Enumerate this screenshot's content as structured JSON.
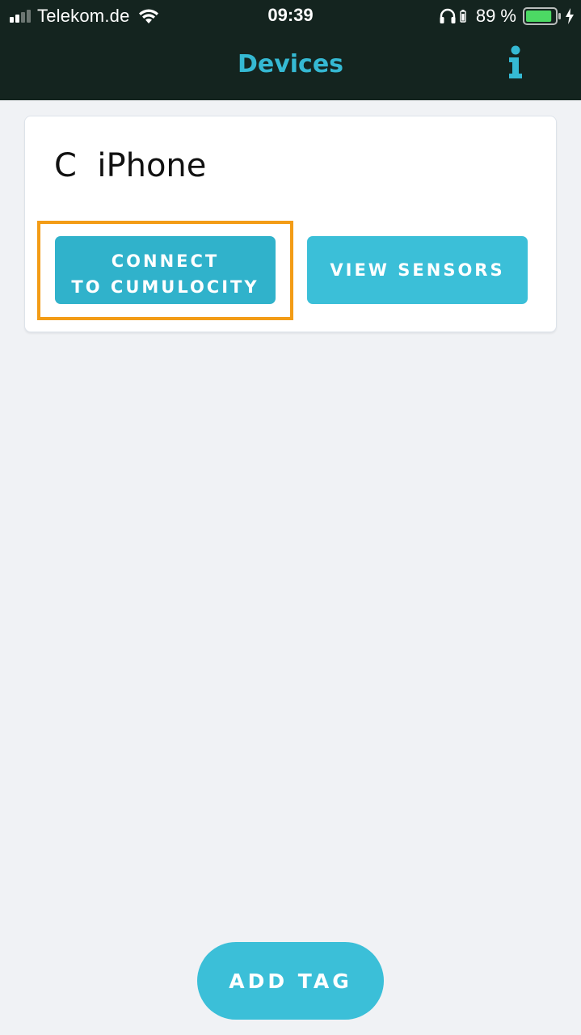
{
  "status_bar": {
    "carrier": "Telekom.de",
    "time": "09:39",
    "battery_percent": "89 %",
    "signal_bars_active": 2,
    "signal_bars_total": 4,
    "battery_level": 0.89
  },
  "header": {
    "title": "Devices",
    "info_icon": "info-icon"
  },
  "device_card": {
    "name": "C  iPhone",
    "connect_button": {
      "line1": "CONNECT",
      "line2": "TO CUMULOCITY"
    },
    "view_sensors_label": "VIEW SENSORS",
    "highlight_color": "#f39c16"
  },
  "footer": {
    "add_tag_label": "ADD TAG"
  },
  "colors": {
    "header_bg": "#14241f",
    "accent": "#35b9d3",
    "page_bg": "#f0f2f5"
  }
}
